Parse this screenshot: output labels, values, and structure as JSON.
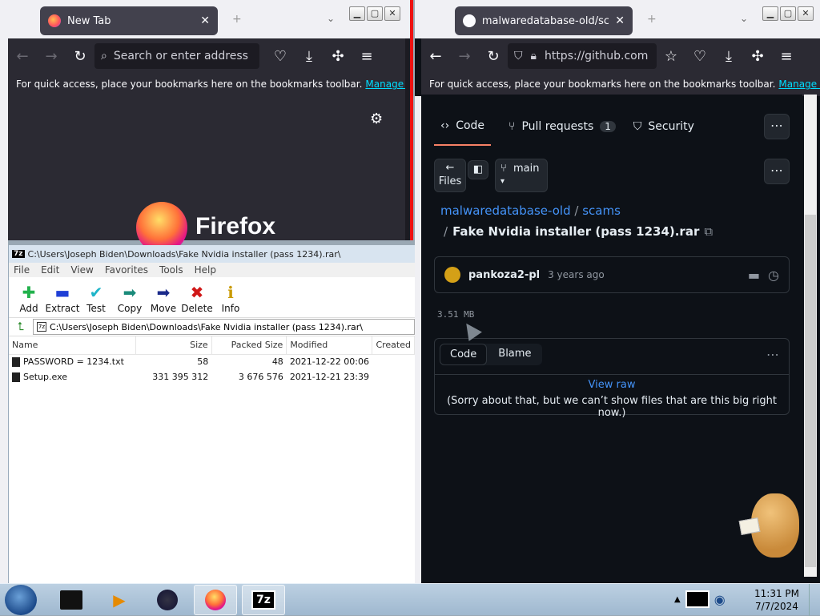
{
  "left_firefox": {
    "tab_title": "New Tab",
    "url_placeholder": "Search or enter address",
    "bookmarks_text": "For quick access, place your bookmarks here on the bookmarks toolbar.",
    "manage_bookmarks": "Manage bookmarks",
    "brand": "Firefox"
  },
  "sevenzip": {
    "title": "C:\\Users\\Joseph Biden\\Downloads\\Fake Nvidia installer (pass 1234).rar\\",
    "menu": [
      "File",
      "Edit",
      "View",
      "Favorites",
      "Tools",
      "Help"
    ],
    "toolbar": [
      {
        "label": "Add",
        "icon": "add-icon"
      },
      {
        "label": "Extract",
        "icon": "extract-icon"
      },
      {
        "label": "Test",
        "icon": "test-icon"
      },
      {
        "label": "Copy",
        "icon": "copy-icon"
      },
      {
        "label": "Move",
        "icon": "move-icon"
      },
      {
        "label": "Delete",
        "icon": "delete-icon"
      },
      {
        "label": "Info",
        "icon": "info-icon"
      }
    ],
    "path": "C:\\Users\\Joseph Biden\\Downloads\\Fake Nvidia installer (pass 1234).rar\\",
    "columns": [
      "Name",
      "Size",
      "Packed Size",
      "Modified",
      "Created"
    ],
    "files": [
      {
        "name": "PASSWORD = 1234.txt",
        "size": "58",
        "packed": "48",
        "modified": "2021-12-22 00:06",
        "created": ""
      },
      {
        "name": "Setup.exe",
        "size": "331 395 312",
        "packed": "3 676 576",
        "modified": "2021-12-21 23:39",
        "created": ""
      }
    ]
  },
  "right_firefox": {
    "tab_title": "malwaredatabase-old/scams/F",
    "url": "https://github.com",
    "bookmarks_text": "For quick access, place your bookmarks here on the bookmarks toolbar.",
    "manage_bookmarks": "Manage bookmarks"
  },
  "github": {
    "tabs": {
      "code": "Code",
      "pulls": "Pull requests",
      "pulls_count": "1",
      "security": "Security"
    },
    "files_btn": "Files",
    "branch": "main",
    "repo": "malwaredatabase-old",
    "sep": "/",
    "folder": "scams",
    "file_prefix": "/",
    "filename": "Fake Nvidia installer (pass 1234).rar",
    "author": "pankoza2-pl",
    "time": "3 years ago",
    "size": "3.51 MB",
    "view_code": "Code",
    "view_blame": "Blame",
    "view_raw": "View raw",
    "too_big": "(Sorry about that, but we can’t show files that are this big right now.)"
  },
  "taskbar": {
    "time": "11:31 PM",
    "date": "7/7/2024",
    "sevenzip_label": "7z"
  },
  "colors": {
    "ff_dark": "#1c1b22",
    "gh_bg": "#0d1117",
    "gh_link": "#4493f8",
    "accent_underline": "#f78166"
  }
}
